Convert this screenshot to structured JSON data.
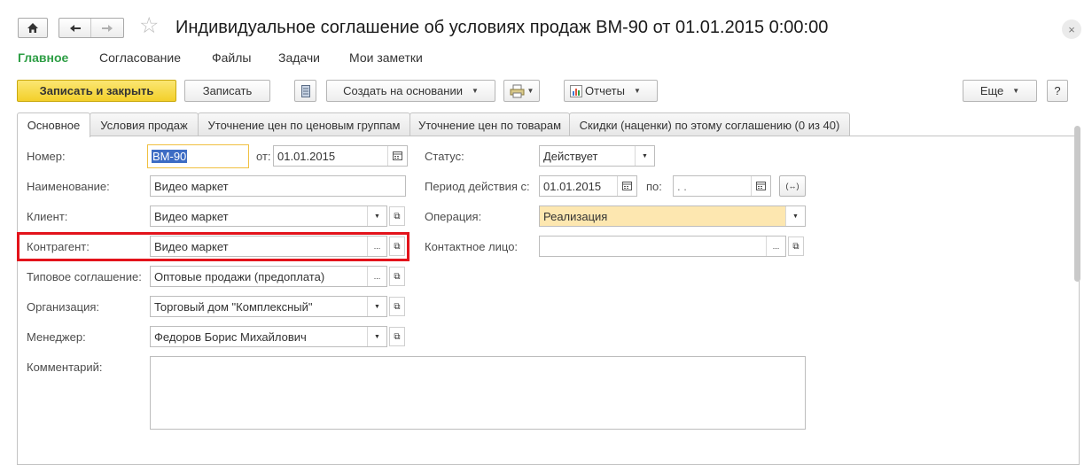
{
  "window": {
    "title": "Индивидуальное соглашение об условиях продаж ВМ-90 от 01.01.2015 0:00:00",
    "close_symbol": "×",
    "star_symbol": "☆"
  },
  "sections": [
    {
      "label": "Главное",
      "active": true
    },
    {
      "label": "Согласование"
    },
    {
      "label": "Файлы"
    },
    {
      "label": "Задачи"
    },
    {
      "label": "Мои заметки"
    }
  ],
  "toolbar": {
    "save_close": "Записать и закрыть",
    "save": "Записать",
    "create_based": "Создать на основании",
    "reports": "Отчеты",
    "more": "Еще",
    "help": "?"
  },
  "tabs": [
    {
      "label": "Основное",
      "active": true
    },
    {
      "label": "Условия продаж"
    },
    {
      "label": "Уточнение цен по ценовым группам"
    },
    {
      "label": "Уточнение цен по товарам"
    },
    {
      "label": "Скидки (наценки) по этому соглашению (0 из 40)"
    }
  ],
  "form": {
    "number_label": "Номер:",
    "number_value": "ВМ-90",
    "from_label": "от:",
    "from_value": "01.01.2015",
    "name_label": "Наименование:",
    "name_value": "Видео маркет",
    "client_label": "Клиент:",
    "client_value": "Видео маркет",
    "contractor_label": "Контрагент:",
    "contractor_value": "Видео маркет",
    "standard_agreement_label": "Типовое соглашение:",
    "standard_agreement_value": "Оптовые продажи (предоплата)",
    "organization_label": "Организация:",
    "organization_value": "Торговый дом \"Комплексный\"",
    "manager_label": "Менеджер:",
    "manager_value": "Федоров Борис Михайлович",
    "comment_label": "Комментарий:",
    "comment_value": "",
    "status_label": "Статус:",
    "status_value": "Действует",
    "period_label": "Период действия с:",
    "period_from_value": "01.01.2015",
    "period_to_label": "по:",
    "period_to_value": " .  .",
    "operation_label": "Операция:",
    "operation_value": "Реализация",
    "contact_label": "Контактное лицо:",
    "contact_value": ""
  },
  "glyphs": {
    "dots": "...",
    "arrow_down": "▼",
    "open": "⧉",
    "period_toggle": "(↔)"
  },
  "colors": {
    "primary_button": "#f5d63a",
    "active_section": "#2e9e45",
    "highlight_frame": "#e3131b",
    "operation_field": "#fde7b0"
  }
}
